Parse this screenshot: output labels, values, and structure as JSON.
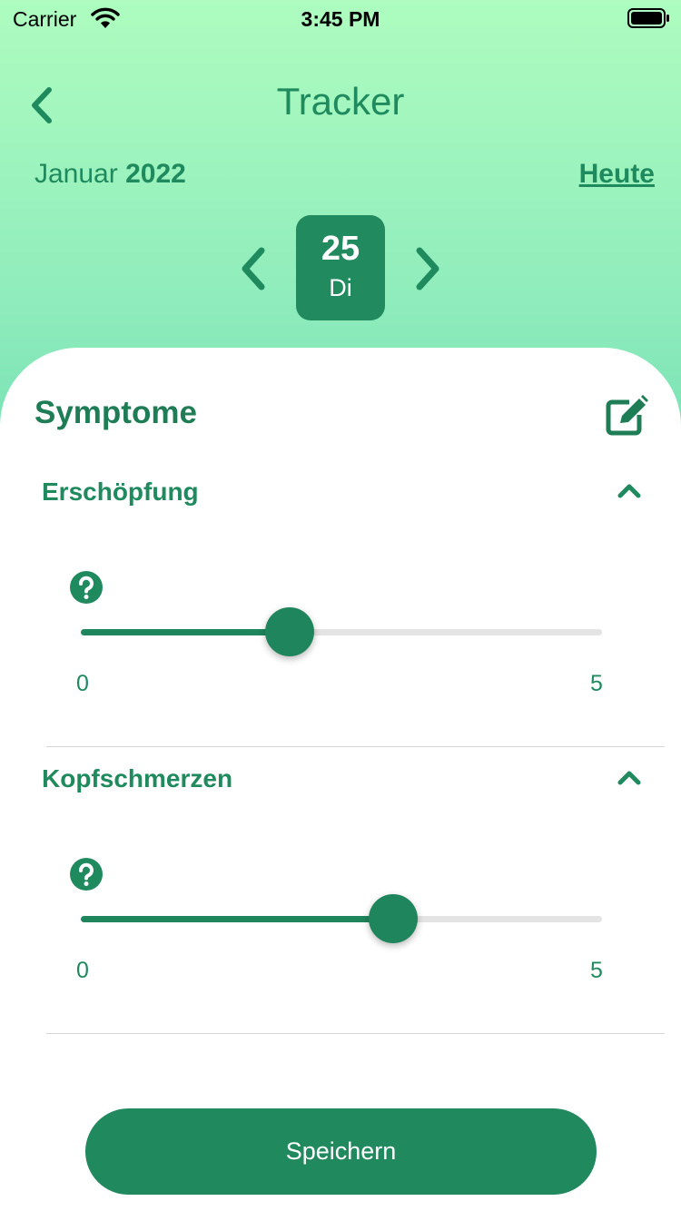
{
  "status_bar": {
    "carrier": "Carrier",
    "time": "3:45 PM"
  },
  "header": {
    "title": "Tracker",
    "month": "Januar",
    "year": "2022",
    "today_label": "Heute"
  },
  "day": {
    "number": "25",
    "name": "Di"
  },
  "colors": {
    "accent": "#218a5e",
    "gradient_top": "#aefcbf",
    "gradient_bottom": "#7ee4b6"
  },
  "section": {
    "title": "Symptome"
  },
  "symptoms": [
    {
      "name": "Erschöpfung",
      "value": 2,
      "min_label": "0",
      "max_label": "5",
      "min": 0,
      "max": 5
    },
    {
      "name": "Kopfschmerzen",
      "value": 3,
      "min_label": "0",
      "max_label": "5",
      "min": 0,
      "max": 5
    }
  ],
  "save_label": "Speichern",
  "icons": [
    "wifi-icon",
    "battery-icon",
    "back-chevron-icon",
    "prev-day-icon",
    "next-day-icon",
    "edit-icon",
    "chevron-up-icon",
    "help-icon"
  ]
}
